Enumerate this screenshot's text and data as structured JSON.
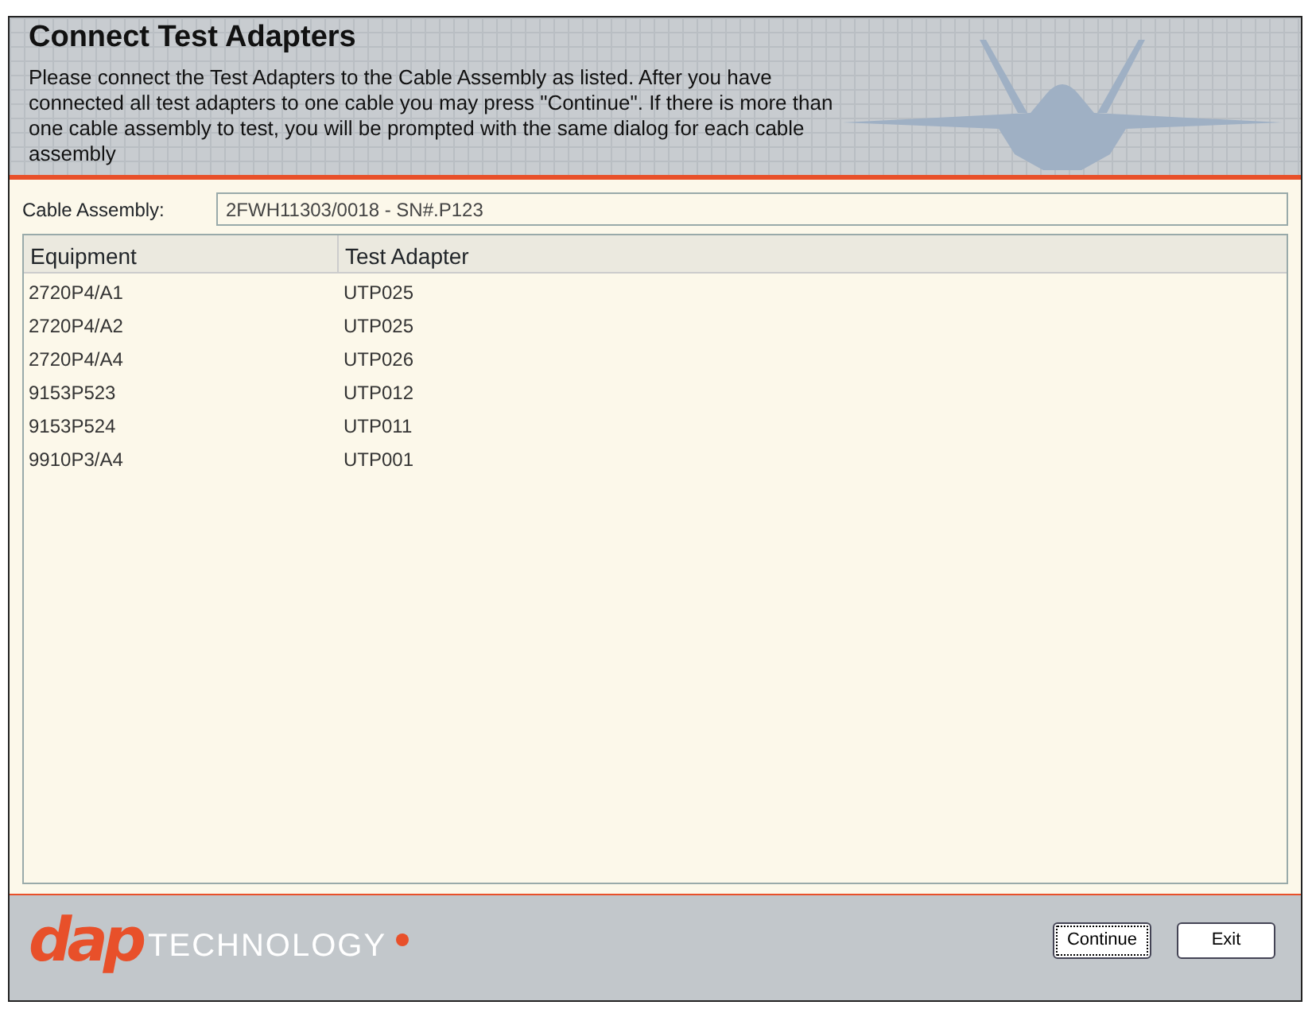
{
  "header": {
    "title": "Connect Test Adapters",
    "instructions": "Please connect the Test Adapters to the Cable Assembly as listed. After you have connected all test adapters to one cable you may press \"Continue\". If there is more than one cable assembly to test, you will be prompted with the same dialog for each cable assembly"
  },
  "cable_assembly": {
    "label": "Cable Assembly:",
    "value": "2FWH11303/0018 - SN#.P123"
  },
  "table": {
    "columns": [
      "Equipment",
      "Test Adapter"
    ],
    "rows": [
      [
        "2720P4/A1",
        "UTP025"
      ],
      [
        "2720P4/A2",
        "UTP025"
      ],
      [
        "2720P4/A4",
        "UTP026"
      ],
      [
        "9153P523",
        "UTP012"
      ],
      [
        "9153P524",
        "UTP011"
      ],
      [
        "9910P3/A4",
        "UTP001"
      ]
    ]
  },
  "logo": {
    "mark": "dap",
    "word": "TECHNOLOGY"
  },
  "buttons": [
    {
      "label": "Continue",
      "focused": true
    },
    {
      "label": "Exit",
      "focused": false
    }
  ]
}
